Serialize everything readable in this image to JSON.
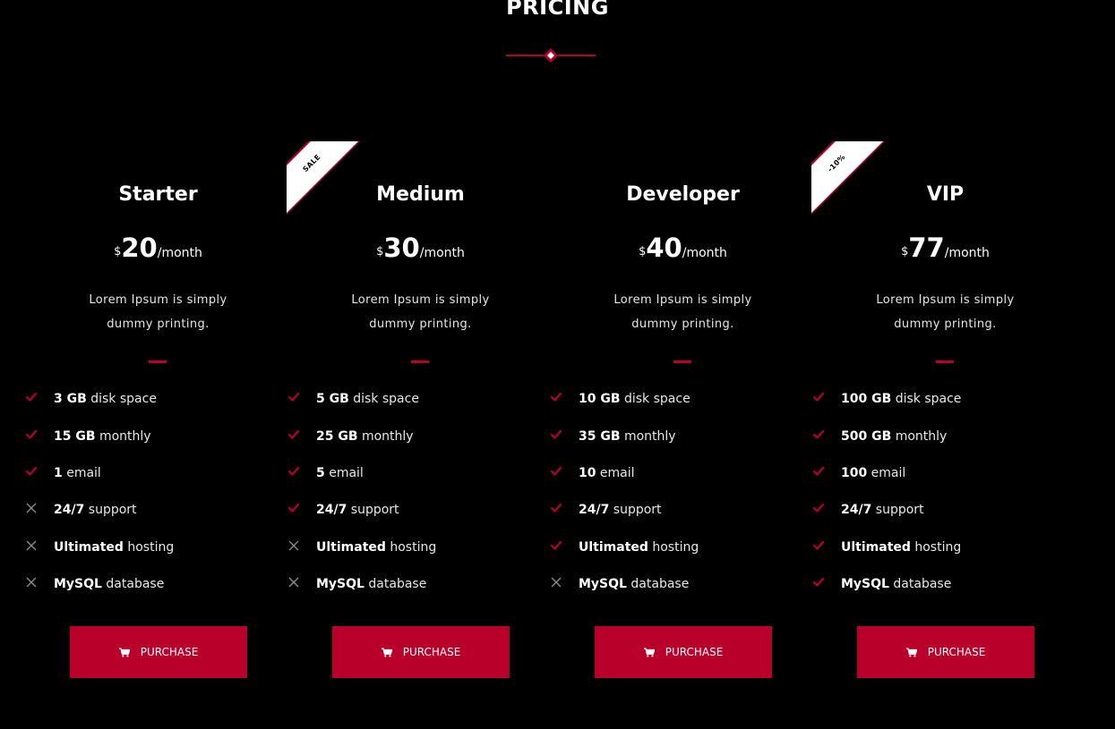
{
  "section": {
    "title": "PRICING"
  },
  "colors": {
    "accent": "#b8002a",
    "background": "#000000",
    "text": "#ffffff",
    "cross": "#8a8a8a"
  },
  "plans": [
    {
      "name": "Starter",
      "currency": "$",
      "amount": "20",
      "period": "/month",
      "description": "Lorem Ipsum is simply dummy printing.",
      "ribbon": null,
      "features": [
        {
          "bold": "3 GB",
          "text": " disk space",
          "included": true
        },
        {
          "bold": "15 GB",
          "text": " monthly",
          "included": true
        },
        {
          "bold": "1",
          "text": " email",
          "included": true
        },
        {
          "bold": "24/7",
          "text": " support",
          "included": false
        },
        {
          "bold": "Ultimated",
          "text": " hosting",
          "included": false
        },
        {
          "bold": "MySQL",
          "text": " database",
          "included": false
        }
      ],
      "button_label": "PURCHASE",
      "button_icon": "shopping-cart-icon"
    },
    {
      "name": "Medium",
      "currency": "$",
      "amount": "30",
      "period": "/month",
      "description": "Lorem Ipsum is simply dummy printing.",
      "ribbon": "SALE",
      "features": [
        {
          "bold": "5 GB",
          "text": " disk space",
          "included": true
        },
        {
          "bold": "25 GB",
          "text": " monthly",
          "included": true
        },
        {
          "bold": "5",
          "text": " email",
          "included": true
        },
        {
          "bold": "24/7",
          "text": " support",
          "included": true
        },
        {
          "bold": "Ultimated",
          "text": " hosting",
          "included": false
        },
        {
          "bold": "MySQL",
          "text": " database",
          "included": false
        }
      ],
      "button_label": "PURCHASE",
      "button_icon": "shopping-cart-icon"
    },
    {
      "name": "Developer",
      "currency": "$",
      "amount": "40",
      "period": "/month",
      "description": "Lorem Ipsum is simply dummy printing.",
      "ribbon": null,
      "features": [
        {
          "bold": "10 GB",
          "text": " disk space",
          "included": true
        },
        {
          "bold": "35 GB",
          "text": " monthly",
          "included": true
        },
        {
          "bold": "10",
          "text": " email",
          "included": true
        },
        {
          "bold": "24/7",
          "text": " support",
          "included": true
        },
        {
          "bold": "Ultimated",
          "text": " hosting",
          "included": true
        },
        {
          "bold": "MySQL",
          "text": " database",
          "included": false
        }
      ],
      "button_label": "PURCHASE",
      "button_icon": "shopping-cart-icon"
    },
    {
      "name": "VIP",
      "currency": "$",
      "amount": "77",
      "period": "/month",
      "description": "Lorem Ipsum is simply dummy printing.",
      "ribbon": "-10%",
      "features": [
        {
          "bold": "100 GB",
          "text": " disk space",
          "included": true
        },
        {
          "bold": "500 GB",
          "text": " monthly",
          "included": true
        },
        {
          "bold": "100",
          "text": " email",
          "included": true
        },
        {
          "bold": "24/7",
          "text": " support",
          "included": true
        },
        {
          "bold": "Ultimated",
          "text": " hosting",
          "included": true
        },
        {
          "bold": "MySQL",
          "text": " database",
          "included": true
        }
      ],
      "button_label": "PURCHASE",
      "button_icon": "shopping-cart-icon"
    }
  ]
}
